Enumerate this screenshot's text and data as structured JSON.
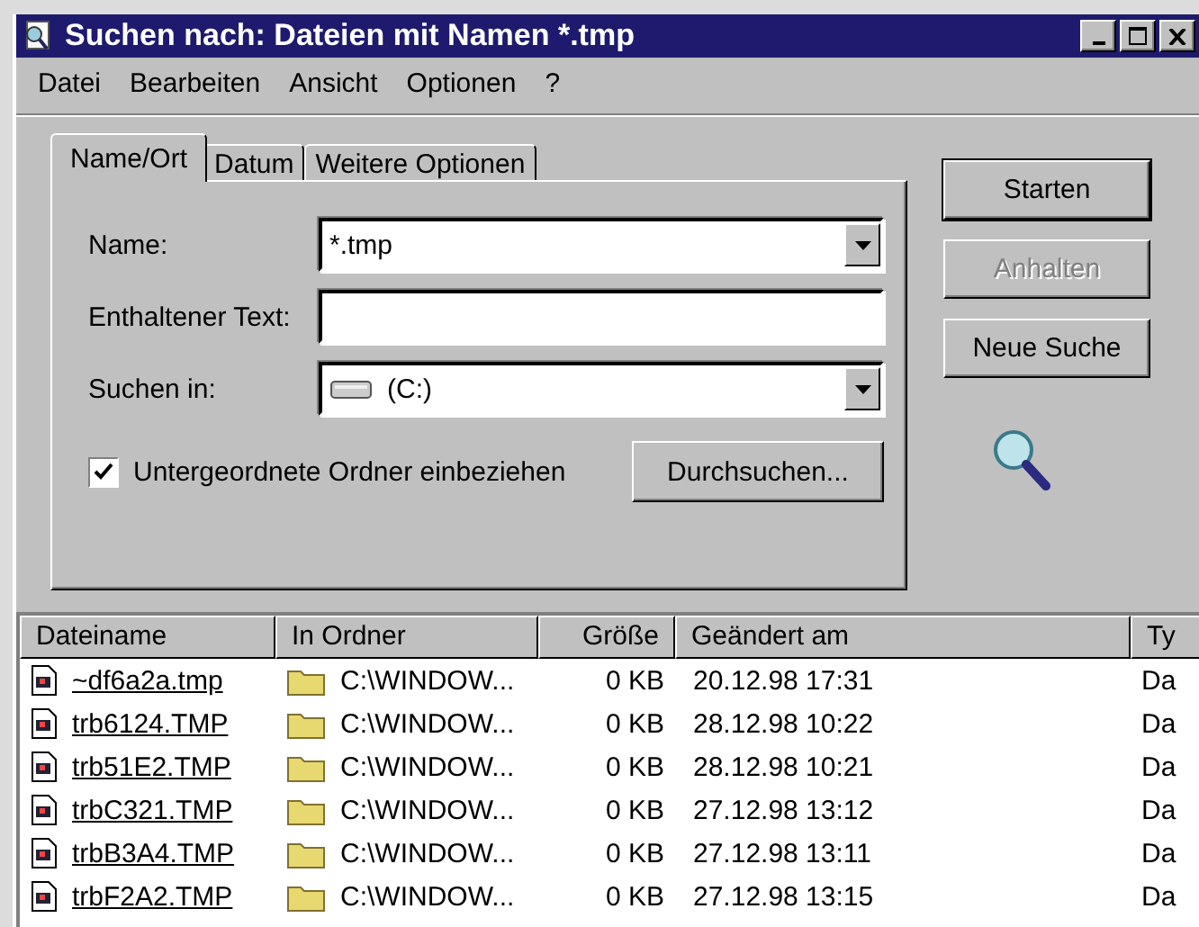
{
  "window": {
    "title": "Suchen nach: Dateien mit Namen *.tmp"
  },
  "menu": [
    "Datei",
    "Bearbeiten",
    "Ansicht",
    "Optionen",
    "?"
  ],
  "tabs": [
    {
      "label": "Name/Ort",
      "selected": true
    },
    {
      "label": "Datum",
      "selected": false
    },
    {
      "label": "Weitere Optionen",
      "selected": false
    }
  ],
  "fields": [
    {
      "kind": "combo",
      "label": "Name:",
      "value": "*.tmp"
    },
    {
      "kind": "text",
      "label": "Enthaltener Text:"
    },
    {
      "kind": "drive",
      "label": "Suchen in:",
      "value": "(C:)"
    }
  ],
  "subfolders": {
    "label": "Untergeordnete Ordner einbeziehen",
    "checked": true
  },
  "browse_button": "Durchsuchen...",
  "buttons": [
    {
      "label": "Starten",
      "disabled": false,
      "default": true
    },
    {
      "label": "Anhalten",
      "disabled": true,
      "default": false
    },
    {
      "label": "Neue Suche",
      "disabled": false,
      "default": false
    }
  ],
  "table": {
    "columns": [
      "Dateiname",
      "In Ordner",
      "Größe",
      "Geändert am",
      "Ty"
    ],
    "rows": [
      {
        "name": "~df6a2a.tmp",
        "folder": "C:\\WINDOW...",
        "size": "0 KB",
        "modified": "20.12.98 17:31",
        "type": "Da"
      },
      {
        "name": "trb6124.TMP",
        "folder": "C:\\WINDOW...",
        "size": "0 KB",
        "modified": "28.12.98 10:22",
        "type": "Da"
      },
      {
        "name": "trb51E2.TMP",
        "folder": "C:\\WINDOW...",
        "size": "0 KB",
        "modified": "28.12.98 10:21",
        "type": "Da"
      },
      {
        "name": "trbC321.TMP",
        "folder": "C:\\WINDOW...",
        "size": "0 KB",
        "modified": "27.12.98 13:12",
        "type": "Da"
      },
      {
        "name": "trbB3A4.TMP",
        "folder": "C:\\WINDOW...",
        "size": "0 KB",
        "modified": "27.12.98 13:11",
        "type": "Da"
      },
      {
        "name": "trbF2A2.TMP",
        "folder": "C:\\WINDOW...",
        "size": "0 KB",
        "modified": "27.12.98 13:15",
        "type": "Da"
      }
    ]
  }
}
